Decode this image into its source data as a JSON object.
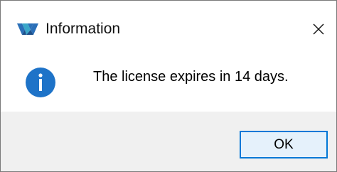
{
  "window": {
    "title": "Information",
    "app_icon": "gowin-logo-icon",
    "close_icon": "close-icon"
  },
  "message": {
    "icon": "info-icon",
    "text": "The license expires in 14 days."
  },
  "buttons": {
    "ok_label": "OK"
  },
  "colors": {
    "info_blue": "#1e73c8",
    "logo_blue": "#2a6fb8",
    "logo_teal": "#3aa7c9",
    "button_border": "#0078d7",
    "button_fill": "#e5f1fb",
    "footer_bg": "#f0f0f0"
  }
}
